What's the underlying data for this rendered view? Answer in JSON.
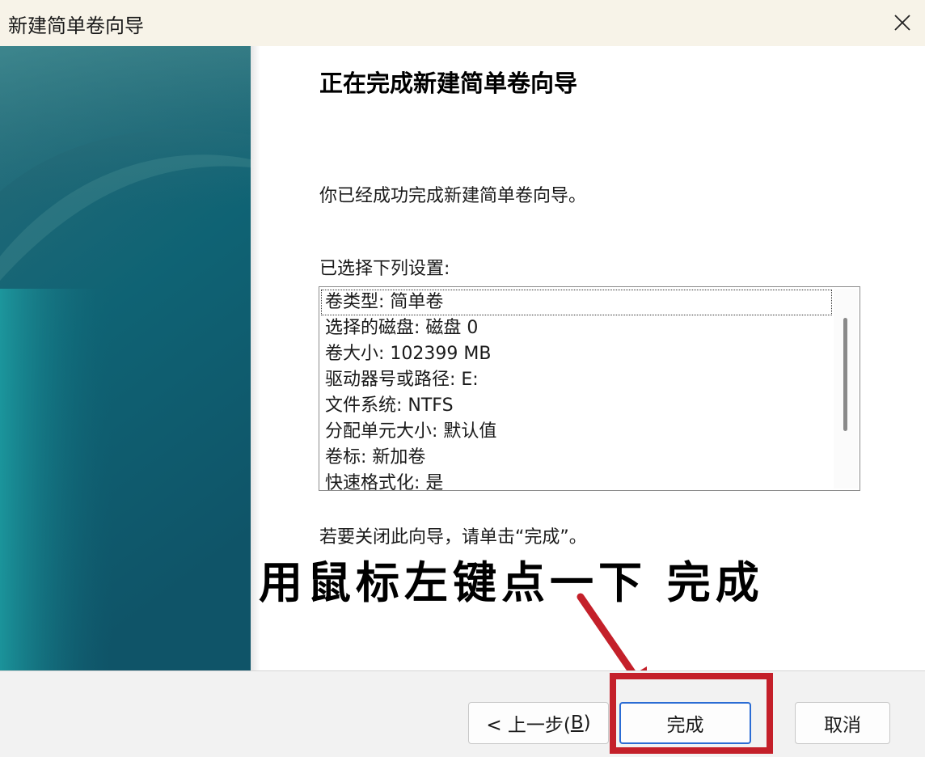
{
  "window": {
    "title": "新建简单卷向导",
    "close_label": "✕"
  },
  "content": {
    "heading": "正在完成新建简单卷向导",
    "success_text": "你已经成功完成新建简单卷向导。",
    "settings_label": "已选择下列设置:",
    "settings": [
      "卷类型: 简单卷",
      "选择的磁盘: 磁盘 0",
      "卷大小: 102399 MB",
      "驱动器号或路径: E:",
      "文件系统: NTFS",
      "分配单元大小: 默认值",
      "卷标: 新加卷",
      "快速格式化: 是"
    ],
    "close_hint": "若要关闭此向导，请单击“完成”。"
  },
  "annotation": {
    "text": "用鼠标左键点一下 完成",
    "color": "#c4202a"
  },
  "buttons": {
    "back_prefix": "< 上一步(",
    "back_key": "B",
    "back_suffix": ")",
    "finish": "完成",
    "cancel": "取消"
  },
  "colors": {
    "titlebar": "#f7f3e8",
    "banner_dark": "#0f5f74",
    "banner_light": "#1b9aa2",
    "footer": "#f2f2f2",
    "accent": "#2b6cd4",
    "highlight": "#c4202a"
  }
}
